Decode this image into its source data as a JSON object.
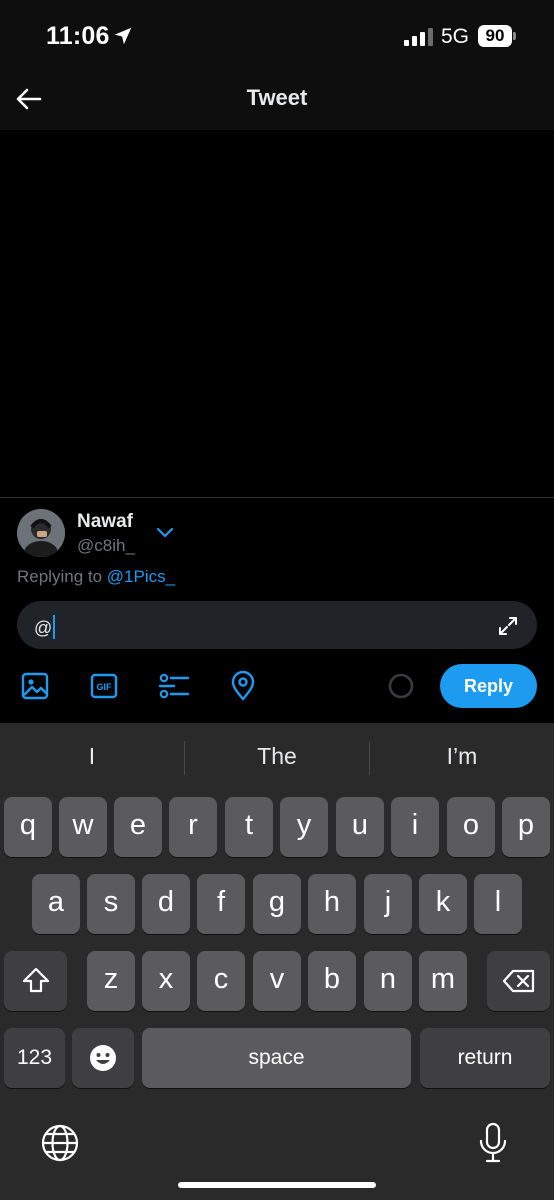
{
  "status_bar": {
    "time": "11:06",
    "network": "5G",
    "battery": "90"
  },
  "header": {
    "title": "Tweet"
  },
  "composer": {
    "user_name": "Nawaf",
    "user_handle": "@c8ih_",
    "replying_prefix": "Replying to ",
    "replying_handle": "@1Pics_",
    "input_value": "@",
    "reply_label": "Reply",
    "accent_color": "#1d9bf0"
  },
  "toolbar_icons": [
    "image-icon",
    "gif-icon",
    "poll-icon",
    "location-pin-icon"
  ],
  "keyboard": {
    "suggestions": [
      "I",
      "The",
      "I’m"
    ],
    "row1": [
      "q",
      "w",
      "e",
      "r",
      "t",
      "y",
      "u",
      "i",
      "o",
      "p"
    ],
    "row2": [
      "a",
      "s",
      "d",
      "f",
      "g",
      "h",
      "j",
      "k",
      "l"
    ],
    "row3": [
      "z",
      "x",
      "c",
      "v",
      "b",
      "n",
      "m"
    ],
    "numbers_label": "123",
    "space_label": "space",
    "return_label": "return"
  }
}
